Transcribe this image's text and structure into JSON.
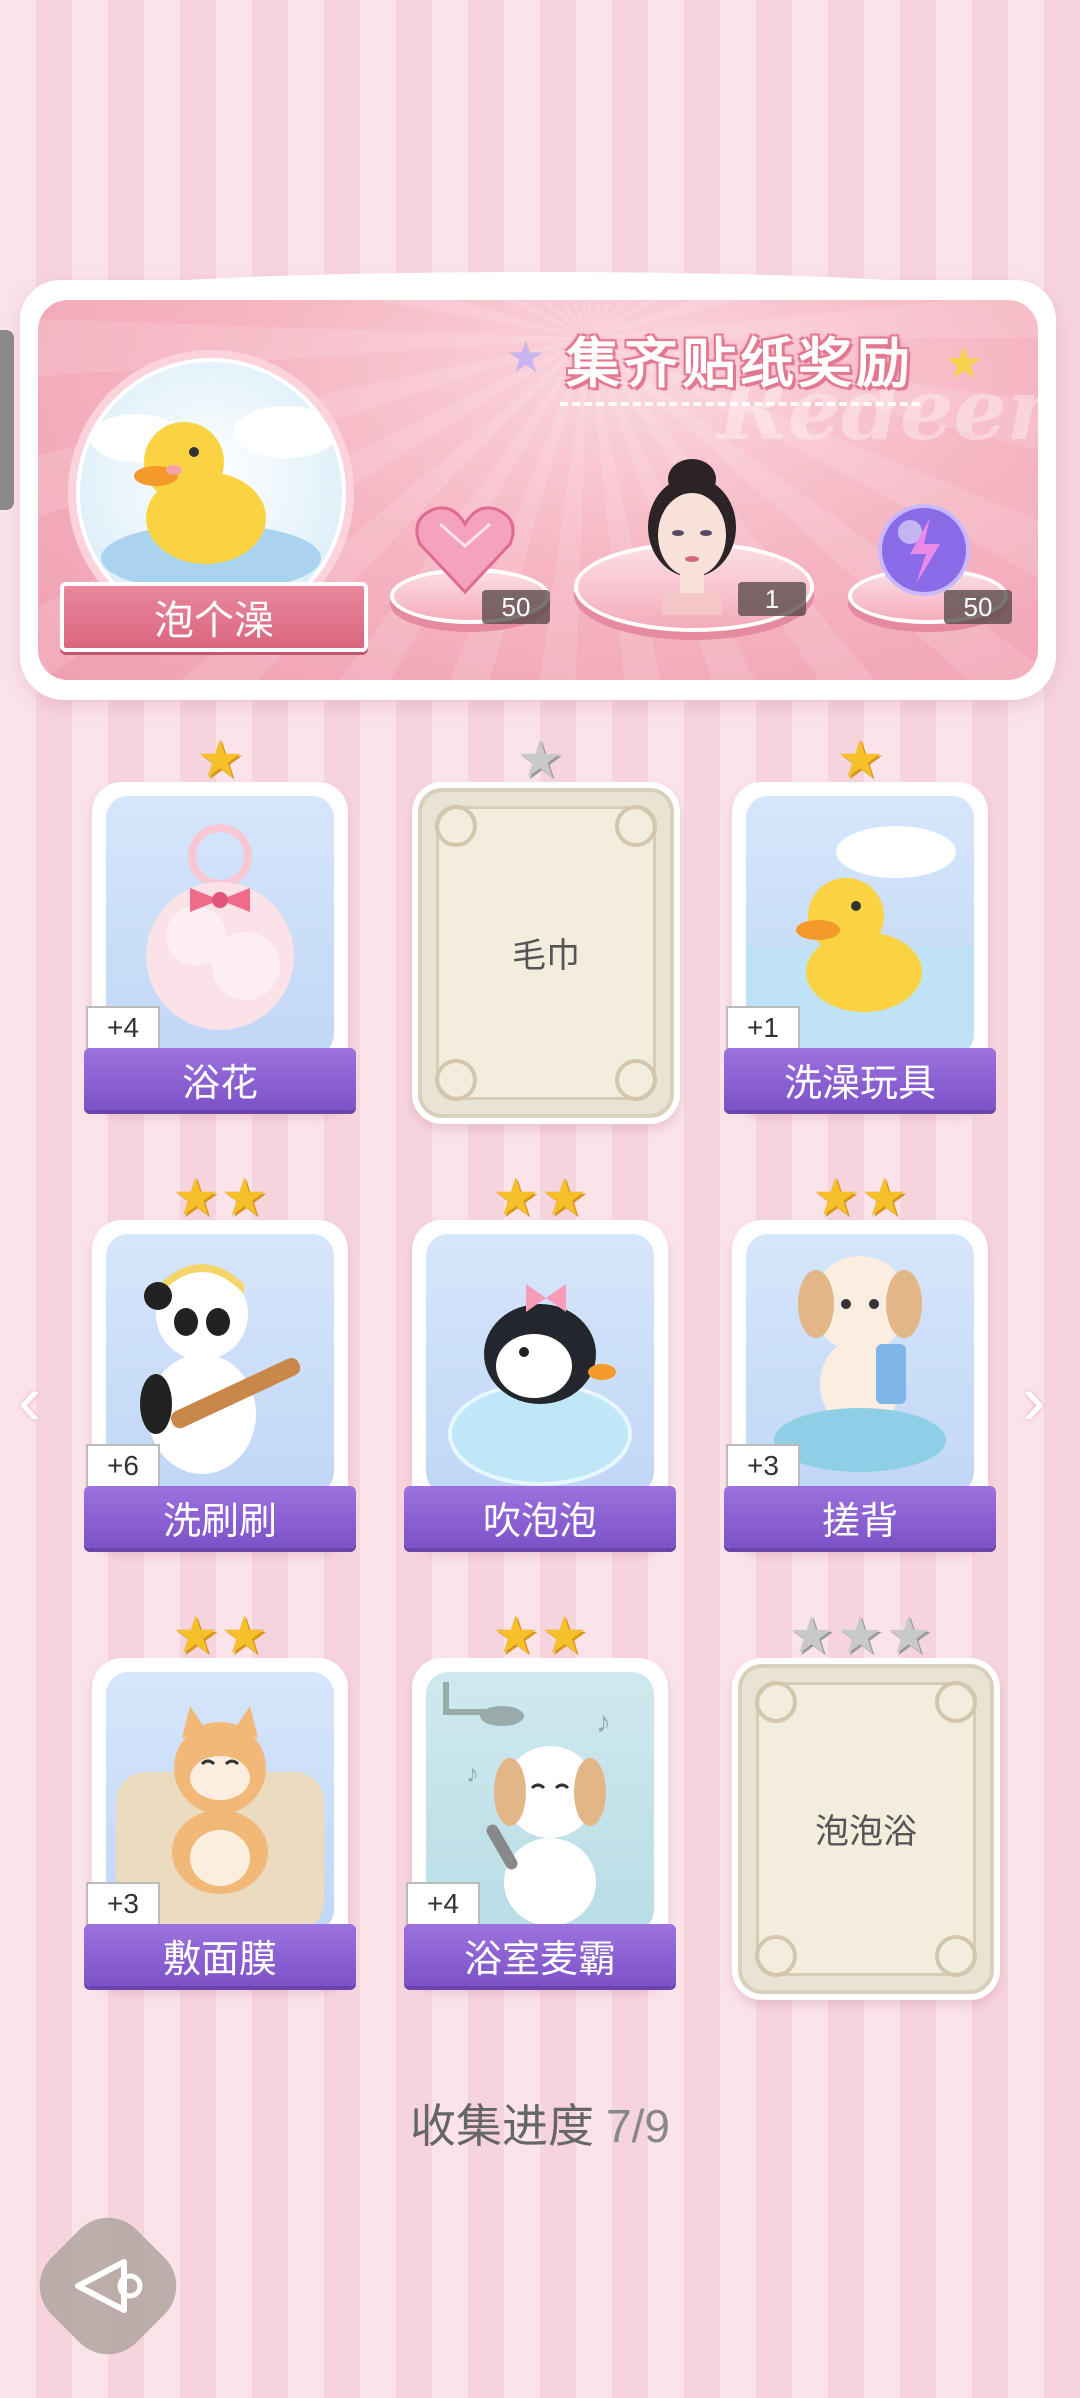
{
  "banner": {
    "title": "集齐贴纸奖励",
    "watermark": "Redeem",
    "album_name": "泡个澡",
    "rewards": [
      {
        "name": "heart-gem",
        "count": "50"
      },
      {
        "name": "avatar",
        "count": "1"
      },
      {
        "name": "energy-orb",
        "count": "50"
      }
    ]
  },
  "cards": [
    {
      "name": "浴花",
      "stars": 1,
      "collected": true,
      "plus": "+4",
      "art": "bath-pouf"
    },
    {
      "name": "毛巾",
      "stars": 1,
      "collected": false
    },
    {
      "name": "洗澡玩具",
      "stars": 1,
      "collected": true,
      "plus": "+1",
      "art": "duck"
    },
    {
      "name": "洗刷刷",
      "stars": 2,
      "collected": true,
      "plus": "+6",
      "art": "panda"
    },
    {
      "name": "吹泡泡",
      "stars": 2,
      "collected": true,
      "plus": "",
      "art": "penguin"
    },
    {
      "name": "搓背",
      "stars": 2,
      "collected": true,
      "plus": "+3",
      "art": "puppy"
    },
    {
      "name": "敷面膜",
      "stars": 2,
      "collected": true,
      "plus": "+3",
      "art": "cat"
    },
    {
      "name": "浴室麦霸",
      "stars": 2,
      "collected": true,
      "plus": "+4",
      "art": "singing-dog"
    },
    {
      "name": "泡泡浴",
      "stars": 3,
      "collected": false
    }
  ],
  "progress": {
    "label": "收集进度",
    "value": "7/9"
  },
  "nav": {
    "prev": "‹",
    "next": "›"
  },
  "colors": {
    "label_purple": "#8a5fd3",
    "star_gold": "#f5c02a",
    "banner_pink": "#f3a9b9"
  }
}
